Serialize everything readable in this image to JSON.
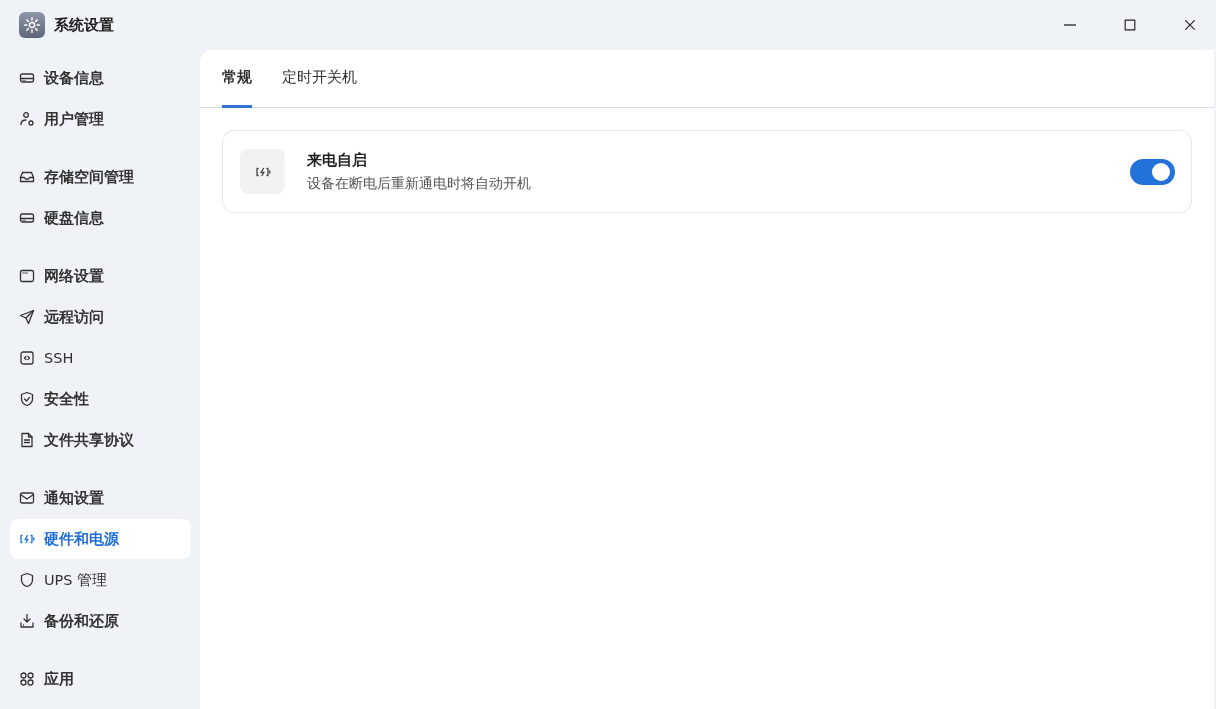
{
  "window": {
    "title": "系统设置"
  },
  "sidebar": {
    "groups": [
      {
        "items": [
          {
            "label": "设备信息",
            "selected": false
          },
          {
            "label": "用户管理",
            "selected": false
          }
        ]
      },
      {
        "items": [
          {
            "label": "存储空间管理",
            "selected": false
          },
          {
            "label": "硬盘信息",
            "selected": false
          }
        ]
      },
      {
        "items": [
          {
            "label": "网络设置",
            "selected": false
          },
          {
            "label": "远程访问",
            "selected": false
          },
          {
            "label": "SSH",
            "selected": false
          },
          {
            "label": "安全性",
            "selected": false
          },
          {
            "label": "文件共享协议",
            "selected": false
          }
        ]
      },
      {
        "items": [
          {
            "label": "通知设置",
            "selected": false
          },
          {
            "label": "硬件和电源",
            "selected": true
          },
          {
            "label": "UPS 管理",
            "selected": false
          },
          {
            "label": "备份和还原",
            "selected": false
          }
        ]
      },
      {
        "items": [
          {
            "label": "应用",
            "selected": false
          }
        ]
      }
    ]
  },
  "tabs": [
    {
      "label": "常规",
      "selected": true
    },
    {
      "label": "定时开关机",
      "selected": false
    }
  ],
  "settings": [
    {
      "title": "来电自启",
      "description": "设备在断电后重新通电时将自动开机",
      "on": true
    }
  ]
}
